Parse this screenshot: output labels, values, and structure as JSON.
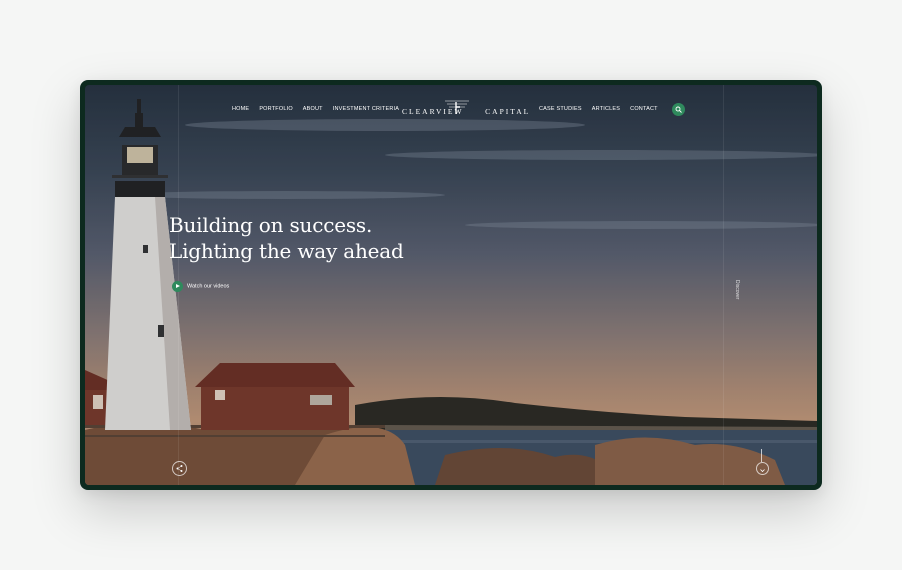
{
  "nav": {
    "left": [
      "HOME",
      "PORTFOLIO",
      "ABOUT",
      "INVESTMENT CRITERIA"
    ],
    "right": [
      "CASE STUDIES",
      "ARTICLES",
      "CONTACT"
    ]
  },
  "logo": {
    "left": "CLEARVIEW",
    "right": "CAPITAL"
  },
  "hero": {
    "line1": "Building on success.",
    "line2": "Lighting the way ahead"
  },
  "cta": {
    "label": "Watch our videos"
  },
  "side": {
    "discover": "Discover"
  },
  "colors": {
    "accent": "#2f8a5d",
    "frame": "#0d2a1f"
  },
  "icons": {
    "search": "search-icon",
    "play": "play-icon",
    "share": "share-icon",
    "down": "arrow-down-icon"
  }
}
